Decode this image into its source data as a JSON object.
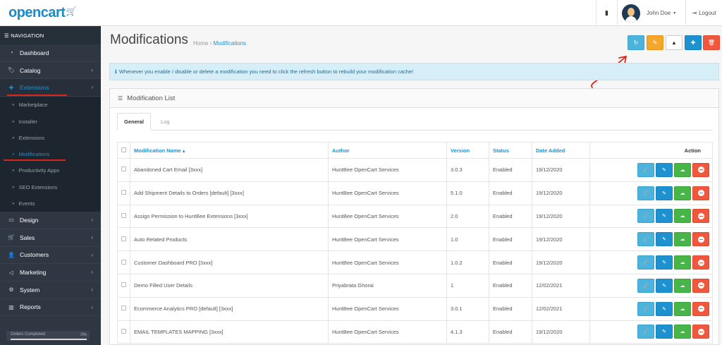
{
  "header": {
    "logo_text": "opencart",
    "logo_cart": "🛒",
    "bookmark_icon": "▮",
    "user_name": "John Doe",
    "caret": "▾",
    "logout_label": "Logout",
    "logout_icon": "⇥"
  },
  "sidebar": {
    "title": "☰ NAVIGATION",
    "items": [
      {
        "label": "Dashboard",
        "icon": "◔",
        "chevron": ""
      },
      {
        "label": "Catalog",
        "icon": "🏷",
        "chevron": "›"
      },
      {
        "label": "Extensions",
        "icon": "✚",
        "chevron": "›"
      },
      {
        "label": "Design",
        "icon": "▭",
        "chevron": "›"
      },
      {
        "label": "Sales",
        "icon": "🛒",
        "chevron": "›"
      },
      {
        "label": "Customers",
        "icon": "👤",
        "chevron": "›"
      },
      {
        "label": "Marketing",
        "icon": "◁",
        "chevron": "›"
      },
      {
        "label": "System",
        "icon": "⚙",
        "chevron": "›"
      },
      {
        "label": "Reports",
        "icon": "▥",
        "chevron": "›"
      }
    ],
    "sub_arrow": "»",
    "extensions_sub": [
      {
        "label": "Marketplace"
      },
      {
        "label": "Installer"
      },
      {
        "label": "Extensions"
      },
      {
        "label": "Modifications"
      },
      {
        "label": "Productivity Apps"
      },
      {
        "label": "SEO Extensions"
      },
      {
        "label": "Events"
      }
    ],
    "progress": {
      "label": "Orders Completed",
      "value": "0%",
      "fraction": 0
    }
  },
  "page": {
    "title": "Modifications",
    "breadcrumb": {
      "home": "Home",
      "sep": "›",
      "current": "Modifications"
    }
  },
  "toolbar": {
    "refresh_icon": "↻",
    "clear_icon": "✎",
    "log_icon": "▲",
    "add_icon": "✚",
    "delete_icon": "🗑"
  },
  "alert": {
    "icon": "ℹ",
    "text": "Whenever you enable / disable or delete a modification you need to click the refresh button to rebuild your modification cache!"
  },
  "panel": {
    "icon": "☰",
    "title": "Modification List",
    "tabs": [
      "General",
      "Log"
    ]
  },
  "table": {
    "headers": {
      "name": "Modification Name ▴",
      "author": "Author",
      "version": "Version",
      "status": "Status",
      "date": "Date Added",
      "action": "Action"
    },
    "action_icons": {
      "link": "🔗",
      "edit": "✎",
      "cloud": "☁",
      "remove": "−"
    },
    "rows": [
      {
        "name": "Abandoned Cart Email [3xxx]",
        "author": "HuntBee OpenCart Services",
        "version": "3.0.3",
        "status": "Enabled",
        "date": "19/12/2020"
      },
      {
        "name": "Add Shipment Details to Orders [default] [3xxx]",
        "author": "HuntBee OpenCart Services",
        "version": "5.1.0",
        "status": "Enabled",
        "date": "19/12/2020"
      },
      {
        "name": "Assign Permission to HuntBee Extensions [3xxx]",
        "author": "HuntBee OpenCart Services",
        "version": "2.0",
        "status": "Enabled",
        "date": "19/12/2020"
      },
      {
        "name": "Auto Related Products",
        "author": "HuntBee OpenCart Services",
        "version": "1.0",
        "status": "Enabled",
        "date": "19/12/2020"
      },
      {
        "name": "Customer Dashboard PRO [3xxx]",
        "author": "HuntBee OpenCart Services",
        "version": "1.0.2",
        "status": "Enabled",
        "date": "19/12/2020"
      },
      {
        "name": "Demo Filled User Details",
        "author": "Priyabrata Ghorai",
        "version": "1",
        "status": "Enabled",
        "date": "12/02/2021"
      },
      {
        "name": "Ecommerce Analytics PRO [default] [3xxx]",
        "author": "HuntBee OpenCart Services",
        "version": "3.0.1",
        "status": "Enabled",
        "date": "12/02/2021"
      },
      {
        "name": "EMAIL TEMPLATES MAPPING [3xxx]",
        "author": "HuntBee OpenCart Services",
        "version": "4.1.3",
        "status": "Enabled",
        "date": "19/12/2020"
      }
    ]
  },
  "colors": {
    "accent": "#1c93cf",
    "sidebar_bg": "#2f3743",
    "annotation_red": "#d9261c",
    "info": "#4cb4dc",
    "warning": "#f4a72c",
    "primary": "#1e91cf",
    "success": "#48b548",
    "danger": "#f0573d"
  }
}
